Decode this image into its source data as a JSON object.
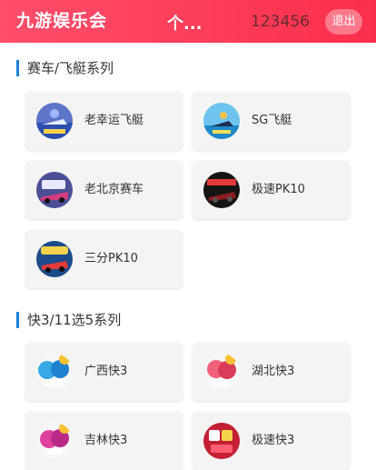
{
  "header": {
    "brand": "九游娱乐会",
    "title": "个...",
    "account": "123456",
    "logout_label": "退出"
  },
  "sections": [
    {
      "title": "赛车/飞艇系列",
      "games": [
        {
          "label": "老幸运飞艇",
          "icon": "lucky-boat-icon"
        },
        {
          "label": "SG飞艇",
          "icon": "jet-ski-icon"
        },
        {
          "label": "老北京赛车",
          "icon": "pk10-car-icon"
        },
        {
          "label": "极速PK10",
          "icon": "speed-car-icon"
        },
        {
          "label": "三分PK10",
          "icon": "three-minute-car-icon"
        }
      ]
    },
    {
      "title": "快3/11选5系列",
      "games": [
        {
          "label": "广西快3",
          "icon": "guangxi-dice-icon"
        },
        {
          "label": "湖北快3",
          "icon": "hubei-dice-icon"
        },
        {
          "label": "吉林快3",
          "icon": "jilin-dice-icon"
        },
        {
          "label": "极速快3",
          "icon": "speed-dice-icon"
        }
      ]
    }
  ],
  "colors": {
    "header_start": "#ff4e6a",
    "header_end": "#fb2f4b",
    "section_bar": "#1e7fd8",
    "card_bg": "#f4f4f4"
  }
}
